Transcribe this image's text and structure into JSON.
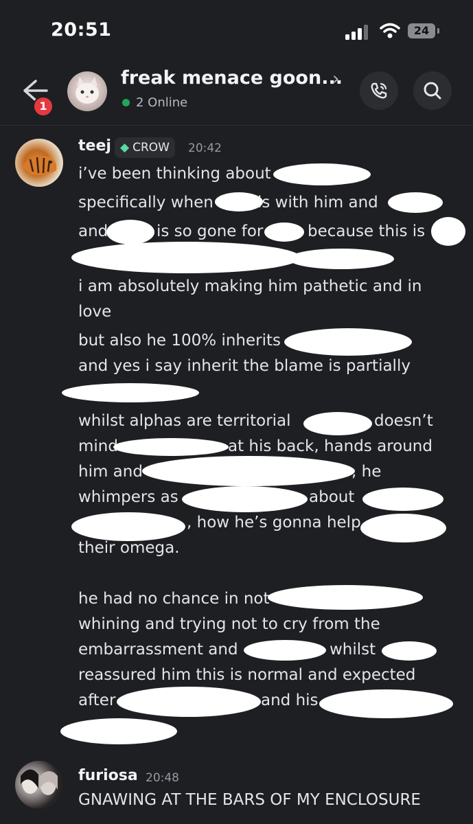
{
  "status_bar": {
    "time": "20:51",
    "battery": "24"
  },
  "header": {
    "title": "freak menace goon...",
    "online": "2 Online",
    "badge_count": "1"
  },
  "messages": [
    {
      "author": "teej",
      "role": "CROW",
      "time": "20:42",
      "lines": [
        "i’ve been thinking about",
        "specifically when",
        "is with him and",
        "and",
        "is so gone for",
        "because this is",
        "i am absolutely making him pathetic and in",
        "love",
        "but also he 100% inherits",
        "and yes i say inherit the blame is partially",
        "whilst alphas are territorial",
        "doesn’t",
        "mind",
        "at his back, hands around",
        "him and",
        ", he",
        "whimpers as",
        "about",
        ", how he’s gonna help",
        "their omega.",
        "he had no chance in not",
        "whining and trying not to cry from the",
        "embarrassment and",
        "whilst",
        "reassured him this is normal and expected",
        "after",
        "and his"
      ]
    },
    {
      "author": "furiosa",
      "time": "20:48",
      "lines": [
        "GNAWING AT THE BARS OF MY ENCLOSURE"
      ]
    }
  ]
}
